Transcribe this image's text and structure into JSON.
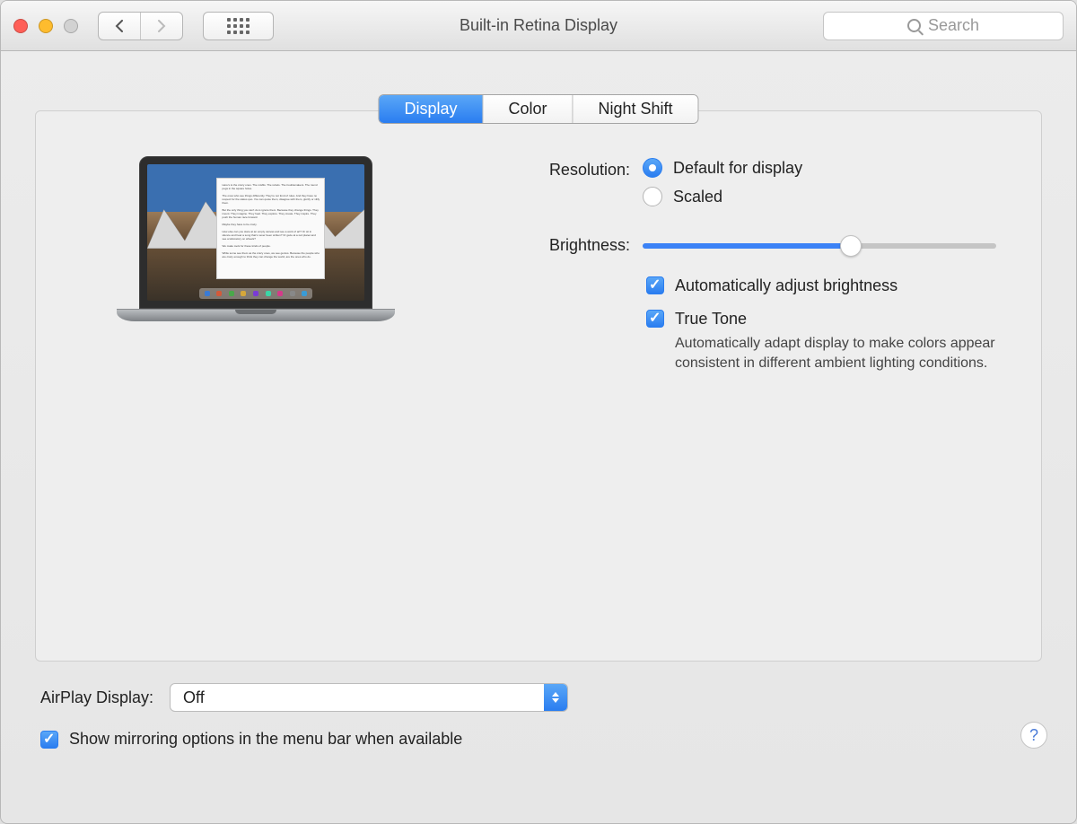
{
  "window": {
    "title": "Built-in Retina Display",
    "search_placeholder": "Search"
  },
  "tabs": [
    "Display",
    "Color",
    "Night Shift"
  ],
  "controls": {
    "resolution_label": "Resolution:",
    "resolution_options": {
      "default": "Default for display",
      "scaled": "Scaled"
    },
    "resolution_selected": "default",
    "brightness_label": "Brightness:",
    "brightness_value": 59,
    "auto_brightness_label": "Automatically adjust brightness",
    "auto_brightness_checked": true,
    "true_tone_label": "True Tone",
    "true_tone_checked": true,
    "true_tone_desc": "Automatically adapt display to make colors appear consistent in different ambient lighting conditions."
  },
  "footer": {
    "airplay_label": "AirPlay Display:",
    "airplay_value": "Off",
    "mirroring_label": "Show mirroring options in the menu bar when available",
    "mirroring_checked": true,
    "help": "?"
  }
}
